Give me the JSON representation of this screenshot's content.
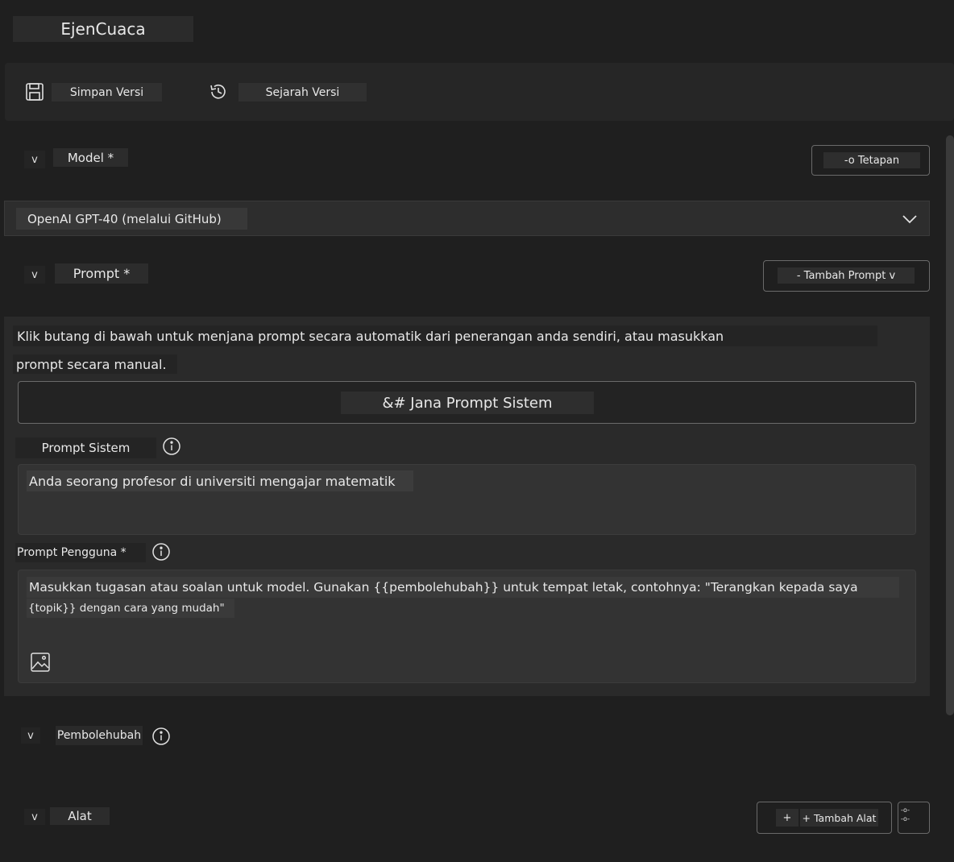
{
  "app": {
    "title": "EjenCuaca"
  },
  "toolbar": {
    "save_label": "Simpan Versi",
    "save_icon": "save-icon",
    "history_label": "Sejarah Versi",
    "history_icon": "history-icon"
  },
  "model_section": {
    "toggle": "v",
    "label": "Model *",
    "defaults_label": "-o Tetapan",
    "selected_value": "OpenAI GPT-40 (melalui GitHub)"
  },
  "prompt_section": {
    "toggle": "v",
    "label": "Prompt *",
    "add_prompt_label": "- Tambah Prompt v",
    "hint_line1": "Klik butang di bawah untuk menjana prompt secara automatik dari penerangan anda sendiri, atau masukkan",
    "hint_line2": "prompt secara manual.",
    "generate_label": "&# Jana Prompt Sistem",
    "system_prompt_label": "Prompt Sistem",
    "system_prompt_value": "Anda seorang profesor di universiti mengajar matematik",
    "user_prompt_label": "Prompt Pengguna *",
    "user_prompt_placeholder_line1": "Masukkan tugasan atau soalan untuk model. Gunakan {{pembolehubah}} untuk tempat letak, contohnya: \"Terangkan kepada saya",
    "user_prompt_placeholder_line2": "{topik}} dengan cara yang mudah\""
  },
  "variables_section": {
    "toggle": "v",
    "label": "Pembolehubah"
  },
  "tools_section": {
    "toggle": "v",
    "label": "Alat",
    "add_tool_plus": "+",
    "add_tool_label": "+ Tambah Alat",
    "settings_glyph_line1": "-o-",
    "settings_glyph_line2": "-o-"
  },
  "colors": {
    "background": "#1f1f1f",
    "panel": "#2a2a2a",
    "input": "#333333",
    "border": "#6a6a6a",
    "text": "#e8e8e8"
  }
}
